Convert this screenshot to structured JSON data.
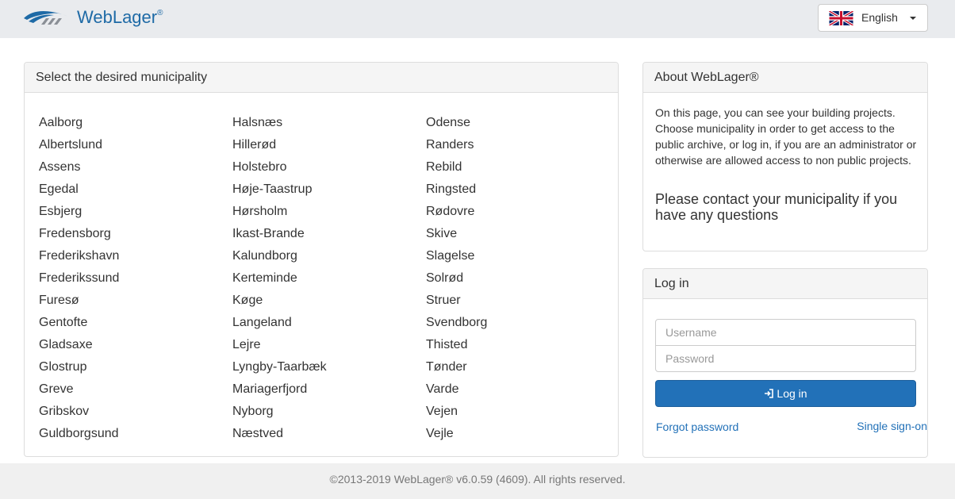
{
  "header": {
    "brand": "WebLager",
    "brand_mark": "®",
    "language": {
      "label": "English",
      "icon": "uk-flag-icon"
    }
  },
  "municipalities": {
    "title": "Select the desired municipality",
    "col1": [
      "Aalborg",
      "Albertslund",
      "Assens",
      "Egedal",
      "Esbjerg",
      "Fredensborg",
      "Frederikshavn",
      "Frederikssund",
      "Furesø",
      "Gentofte",
      "Gladsaxe",
      "Glostrup",
      "Greve",
      "Gribskov",
      "Guldborgsund"
    ],
    "col2": [
      "Halsnæs",
      "Hillerød",
      "Holstebro",
      "Høje-Taastrup",
      "Hørsholm",
      "Ikast-Brande",
      "Kalundborg",
      "Kerteminde",
      "Køge",
      "Langeland",
      "Lejre",
      "Lyngby-Taarbæk",
      "Mariagerfjord",
      "Nyborg",
      "Næstved"
    ],
    "col3": [
      "Odense",
      "Randers",
      "Rebild",
      "Ringsted",
      "Rødovre",
      "Skive",
      "Slagelse",
      "Solrød",
      "Struer",
      "Svendborg",
      "Thisted",
      "Tønder",
      "Varde",
      "Vejen",
      "Vejle"
    ]
  },
  "about": {
    "title": "About WebLager®",
    "body": "On this page, you can see your building projects. Choose municipality in order to get access to the public archive, or log in, if you are an administrator or otherwise are allowed access to non public projects.",
    "contact": "Please contact your municipality if you have any questions"
  },
  "login": {
    "title": "Log in",
    "username_placeholder": "Username",
    "password_placeholder": "Password",
    "button_label": "Log in",
    "button_icon": "sign-in-icon",
    "forgot_label": "Forgot password",
    "sso_label": "Single sign-on"
  },
  "footer": {
    "text": "©2013-2019 WebLager® v6.0.59 (4609). All rights reserved."
  },
  "colors": {
    "brand": "#1e6aa6",
    "primary_button": "#2271b8",
    "topbar": "#e9ebee"
  }
}
